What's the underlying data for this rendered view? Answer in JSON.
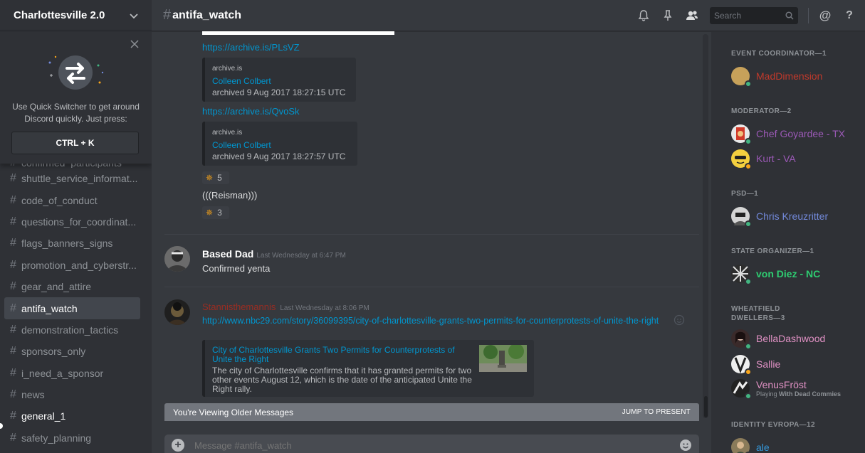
{
  "server": {
    "name": "Charlottesville 2.0"
  },
  "quick_switcher": {
    "text": "Use Quick Switcher to get around Discord quickly. Just press:",
    "keys": "CTRL + K"
  },
  "channels": [
    {
      "name": "confirmed_participants"
    },
    {
      "name": "shuttle_service_informat..."
    },
    {
      "name": "code_of_conduct"
    },
    {
      "name": "questions_for_coordinat..."
    },
    {
      "name": "flags_banners_signs"
    },
    {
      "name": "promotion_and_cyberstr..."
    },
    {
      "name": "gear_and_attire"
    },
    {
      "name": "antifa_watch",
      "active": true
    },
    {
      "name": "demonstration_tactics"
    },
    {
      "name": "sponsors_only"
    },
    {
      "name": "i_need_a_sponsor"
    },
    {
      "name": "news"
    },
    {
      "name": "general_1",
      "unread": true
    },
    {
      "name": "safety_planning"
    }
  ],
  "topbar": {
    "channel": "antifa_watch",
    "search_placeholder": "Search"
  },
  "messages": {
    "link1": "https://archive.is/PLsVZ",
    "embed1": {
      "provider": "archive.is",
      "title": "Colleen Colbert",
      "desc": "archived 9 Aug 2017 18:27:15 UTC"
    },
    "link2": "https://archive.is/QvoSk",
    "embed2": {
      "provider": "archive.is",
      "title": "Colleen Colbert",
      "desc": "archived 9 Aug 2017 18:27:57 UTC"
    },
    "reaction1": {
      "emoji": "✵",
      "count": "5"
    },
    "text_reisman": "(((Reisman)))",
    "reaction2": {
      "emoji": "✵",
      "count": "3"
    },
    "msg2": {
      "author": "Based Dad",
      "timestamp": "Last Wednesday at 6:47 PM",
      "text": "Confirmed yenta"
    },
    "msg3": {
      "author": "Stannisthemannis",
      "author_color": "#992d22",
      "timestamp": "Last Wednesday at 8:06 PM",
      "link": "http://www.nbc29.com/story/36099395/city-of-charlottesville-grants-two-permits-for-counterprotests-of-unite-the-right",
      "embed": {
        "title": "City of Charlottesville Grants Two Permits for Counterprotests of Unite the Right",
        "desc": "The city of Charlottesville confirms that it has granted permits for two other events August 12, which is the date of the anticipated Unite the Right rally."
      }
    }
  },
  "older_bar": {
    "label": "You're Viewing Older Messages",
    "jump": "JUMP TO PRESENT"
  },
  "composer": {
    "placeholder": "Message #antifa_watch"
  },
  "members": {
    "roles": [
      {
        "header": "EVENT COORDINATOR—1"
      },
      {
        "header": "MODERATOR—2"
      },
      {
        "header": "PSD—1"
      },
      {
        "header": "STATE ORGANIZER—1"
      },
      {
        "header": "WHEATFIELD DWELLERS—3"
      },
      {
        "header": "IDENTITY EVROPA—12"
      }
    ],
    "list": [
      {
        "name": "MadDimension",
        "color": "#c0392b"
      },
      {
        "name": "Chef Goyardee - TX",
        "color": "#9b59b6"
      },
      {
        "name": "Kurt - VA",
        "color": "#9b59b6"
      },
      {
        "name": "Chris Kreuzritter",
        "color": "#7289da"
      },
      {
        "name": "von Diez - NC",
        "color": "#2ecc71"
      },
      {
        "name": "BellaDashwood",
        "color": "#e091c4"
      },
      {
        "name": "Sallie",
        "color": "#e091c4"
      },
      {
        "name": "VenusFröst",
        "color": "#e091c4",
        "activity_prefix": "Playing",
        "activity": "With Dead Commies"
      },
      {
        "name": "ale",
        "color": "#3498db"
      }
    ]
  }
}
